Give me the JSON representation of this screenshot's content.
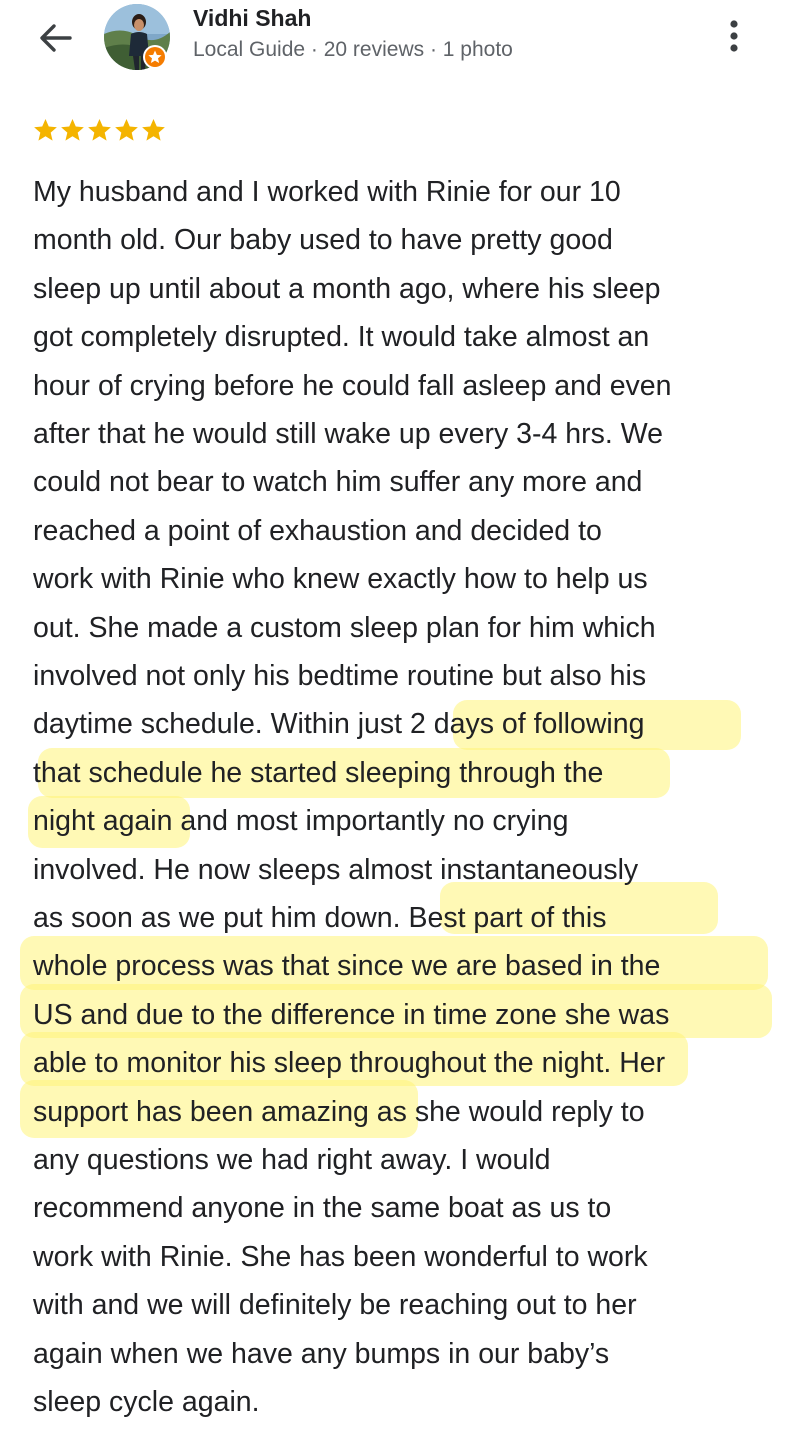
{
  "header": {
    "reviewer_name": "Vidhi Shah",
    "reviewer_meta": "Local Guide · 20 reviews · 1 photo",
    "back_icon": "arrow-left-icon",
    "more_icon": "more-vert-icon",
    "badge_icon": "local-guide-badge-icon"
  },
  "review": {
    "rating": 5,
    "star_color": "#f4b400",
    "highlight_color": "#fff478",
    "lines": [
      "My husband and I worked with Rinie for our 10",
      "month old. Our baby used to have pretty good",
      "sleep up until about a month ago, where his sleep",
      "got completely disrupted. It would take almost an",
      "hour of crying before he could fall asleep and even",
      "after that he would still wake up every 3-4 hrs. We",
      "could not bear to watch him suffer any more and",
      "reached a point of exhaustion and decided to",
      "work with Rinie who knew exactly how to help us",
      "out. She made a custom sleep plan for him which",
      "involved not only his bedtime routine but also his",
      "daytime schedule. Within just 2 days of following",
      "that schedule he started sleeping through the",
      "night again and most importantly no crying",
      "involved. He now sleeps almost instantaneously",
      "as soon as we put him down. Best part of this",
      "whole process was that since we are based in the",
      "US and due to the difference in time zone she was",
      "able to monitor his sleep throughout the night. Her",
      "support has been amazing as she would reply to",
      "any questions we had right away. I would",
      "recommend anyone in the same boat as us to",
      "work with Rinie. She has been wonderful to work",
      "with and we will definitely be reaching out to her",
      "again when we have any bumps in our baby’s",
      "sleep cycle again."
    ]
  }
}
